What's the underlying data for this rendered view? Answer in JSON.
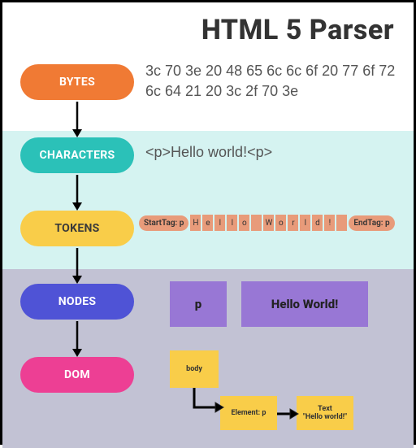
{
  "title": "HTML 5 Parser",
  "stages": {
    "bytes": {
      "label": "BYTES",
      "value": "3c 70 3e 20 48 65 6c 6c 6f 20 77 6f 72 6c 64 21 20 3c 2f 70 3e"
    },
    "characters": {
      "label": "CHARACTERS",
      "value": "<p>Hello world!<p>"
    },
    "tokens": {
      "label": "TOKENS",
      "start": "StartTag: p",
      "chars": [
        "H",
        "e",
        "l",
        "l",
        "o",
        "",
        "W",
        "o",
        "r",
        "l",
        "d",
        "!",
        ""
      ],
      "end": "EndTag: p"
    },
    "nodes": {
      "label": "NODES",
      "a": "p",
      "b": "Hello World!"
    },
    "dom": {
      "label": "DOM",
      "body": "body",
      "element": "Element: p",
      "text_label": "Text",
      "text_value": "\"Hello world!\""
    }
  }
}
